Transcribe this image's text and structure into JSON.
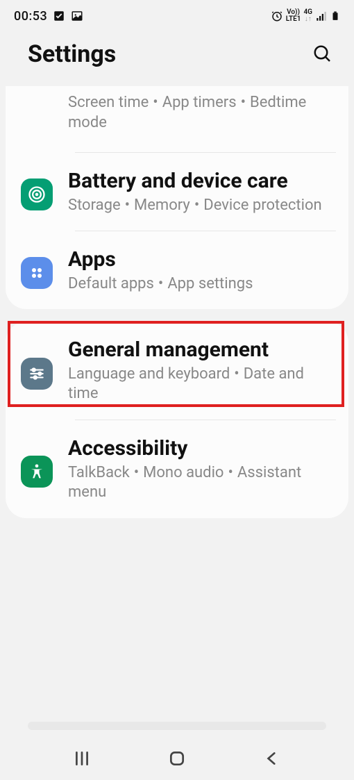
{
  "status_bar": {
    "time": "00:53",
    "indicators": [
      "checkbox",
      "image",
      "alarm",
      "volte",
      "4g",
      "signal",
      "battery"
    ],
    "volte_top": "Vo))",
    "volte_bottom": "LTE1",
    "network": "4G"
  },
  "header": {
    "title": "Settings"
  },
  "groups": [
    {
      "items": [
        {
          "id": "digital-wellbeing-partial",
          "subtitle_parts": [
            "Screen time",
            "App timers",
            "Bedtime mode"
          ],
          "partial": true
        },
        {
          "id": "battery",
          "title": "Battery and device care",
          "subtitle_parts": [
            "Storage",
            "Memory",
            "Device protection"
          ],
          "icon": "battery-care",
          "icon_bg": "#059e73"
        },
        {
          "id": "apps",
          "title": "Apps",
          "subtitle_parts": [
            "Default apps",
            "App settings"
          ],
          "icon": "apps",
          "icon_bg": "#5c8eea",
          "highlighted": true
        }
      ]
    },
    {
      "items": [
        {
          "id": "general",
          "title": "General management",
          "subtitle_parts": [
            "Language and keyboard",
            "Date and time"
          ],
          "icon": "general",
          "icon_bg": "#5c788a"
        },
        {
          "id": "accessibility",
          "title": "Accessibility",
          "subtitle_parts": [
            "TalkBack",
            "Mono audio",
            "Assistant menu"
          ],
          "icon": "accessibility",
          "icon_bg": "#0b9458"
        }
      ]
    }
  ],
  "nav": {
    "recents": "recents",
    "home": "home",
    "back": "back"
  }
}
